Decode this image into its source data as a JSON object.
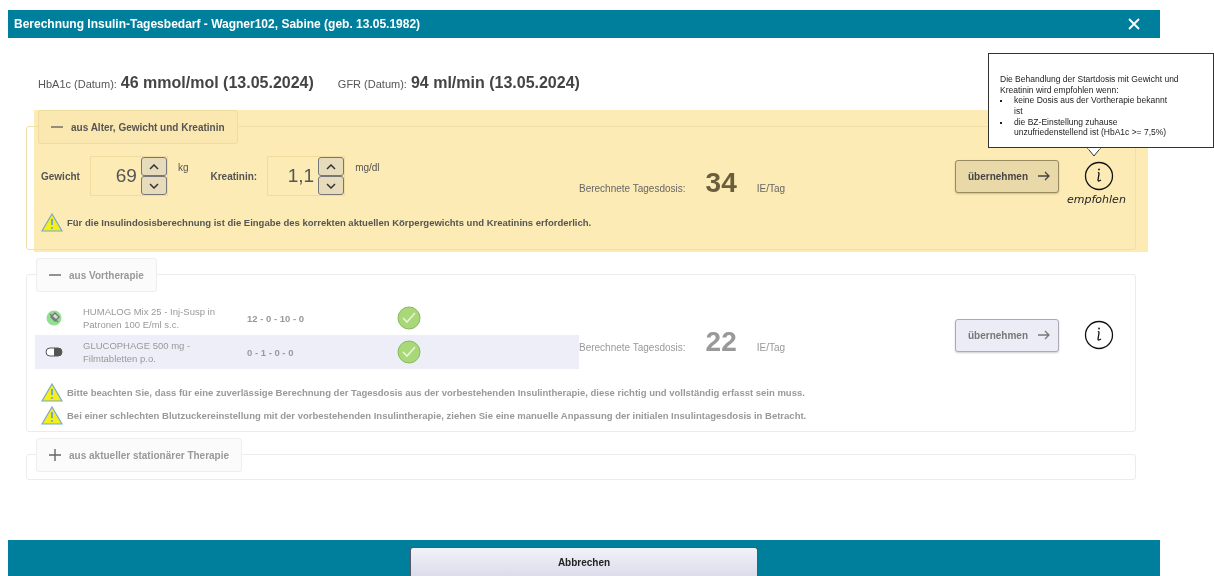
{
  "dialog": {
    "title": "Berechnung Insulin-Tagesbedarf - Wagner102, Sabine (geb. 13.05.1982)"
  },
  "lab_values": [
    {
      "label": "HbA1c (Datum):",
      "value": "46 mmol/mol (13.05.2024)"
    },
    {
      "label": "GFR (Datum):",
      "value": "94 ml/min (13.05.2024)"
    }
  ],
  "sections": [
    {
      "kind": "inputs",
      "title": "aus Alter, Gewicht und Kreatinin",
      "expanded": true,
      "recommended": true,
      "disabled": false,
      "fields": [
        {
          "label": "Gewicht",
          "value": "69",
          "unit": "kg"
        },
        {
          "label": "Kreatinin:",
          "value": "1,1",
          "unit": "mg/dl"
        }
      ],
      "dose_label": "Berechnete Tagesdosis:",
      "dose": "34",
      "dose_unit": "IE/Tag",
      "apply_button": "übernehmen",
      "note": "empfohlen",
      "warnings": [
        "Für die Insulindosisberechnung ist die Eingabe des korrekten aktuellen Körpergewichts und Kreatinins erforderlich."
      ]
    },
    {
      "kind": "medications",
      "title": "aus Vortherapie",
      "expanded": true,
      "recommended": false,
      "disabled": true,
      "medications": [
        {
          "kind": "injection",
          "name": "HUMALOG Mix 25 - Inj-Susp in Patronen 100 E/ml s.c.",
          "schedule": "12 - 0 - 10 - 0",
          "checked": true,
          "selected": false
        },
        {
          "kind": "tablet",
          "name": "GLUCOPHAGE 500 mg - Filmtabletten p.o.",
          "schedule": "0 - 1 - 0 - 0",
          "checked": true,
          "selected": true
        }
      ],
      "dose_label": "Berechnete Tagesdosis:",
      "dose": "22",
      "dose_unit": "IE/Tag",
      "apply_button": "übernehmen",
      "warnings": [
        "Bitte beachten Sie, dass für eine zuverlässige Berechnung der Tagesdosis aus der vorbestehenden Insulintherapie, diese richtig und vollständig erfasst sein muss.",
        "Bei einer schlechten Blutzuckereinstellung mit der vorbestehenden Insulintherapie, ziehen Sie eine manuelle Anpassung der initialen Insulintagesdosis in Betracht."
      ]
    },
    {
      "kind": "empty",
      "title": "aus aktueller stationärer Therapie",
      "expanded": false,
      "recommended": false,
      "disabled": true
    }
  ],
  "tooltip": {
    "intro": "Die Behandlung der Startdosis mit Gewicht und Kreatinin wird empfohlen wenn:",
    "items": [
      "keine Dosis aus der Vortherapie bekannt ist",
      "die BZ-Einstellung zuhause unzufriedenstellend ist (HbA1c >= 7,5%)"
    ]
  },
  "cancel_button": "Abbrechen"
}
